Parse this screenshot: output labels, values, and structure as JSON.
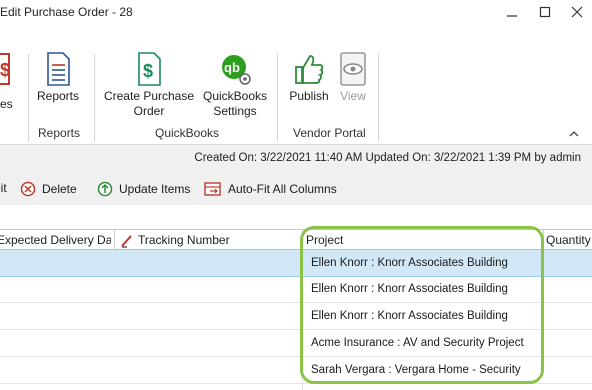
{
  "window": {
    "title": "Edit Purchase Order - 28"
  },
  "ribbon": {
    "partial_label": "es",
    "buttons": {
      "reports": "Reports",
      "create_po": "Create Purchase\nOrder",
      "qb_settings": "QuickBooks\nSettings",
      "publish": "Publish",
      "view": "View"
    },
    "groups": {
      "reports": "Reports",
      "quickbooks": "QuickBooks",
      "vendor_portal": "Vendor Portal"
    }
  },
  "info": {
    "created_updated": "Created On: 3/22/2021 11:40 AM  Updated On: 3/22/2021 1:39 PM by admin"
  },
  "toolbar": {
    "edit_partial": "lit",
    "delete": "Delete",
    "update_items": "Update Items",
    "autofit": "Auto-Fit All Columns"
  },
  "grid": {
    "headers": {
      "expected_delivery": "Expected Delivery Date",
      "tracking": "Tracking Number",
      "project": "Project",
      "quantity": "Quantity"
    },
    "rows": [
      {
        "project": "Ellen Knorr : Knorr Associates Building"
      },
      {
        "project": "Ellen Knorr : Knorr Associates Building"
      },
      {
        "project": "Ellen Knorr : Knorr Associates Building"
      },
      {
        "project": "Acme Insurance : AV and Security Project"
      },
      {
        "project": "Sarah Vergara : Vergara Home - Security"
      }
    ]
  },
  "colors": {
    "highlight": "#8bc34a",
    "selected_row": "#d3e8f7",
    "qb_green": "#2ca01c",
    "accent_red": "#c0392b"
  }
}
